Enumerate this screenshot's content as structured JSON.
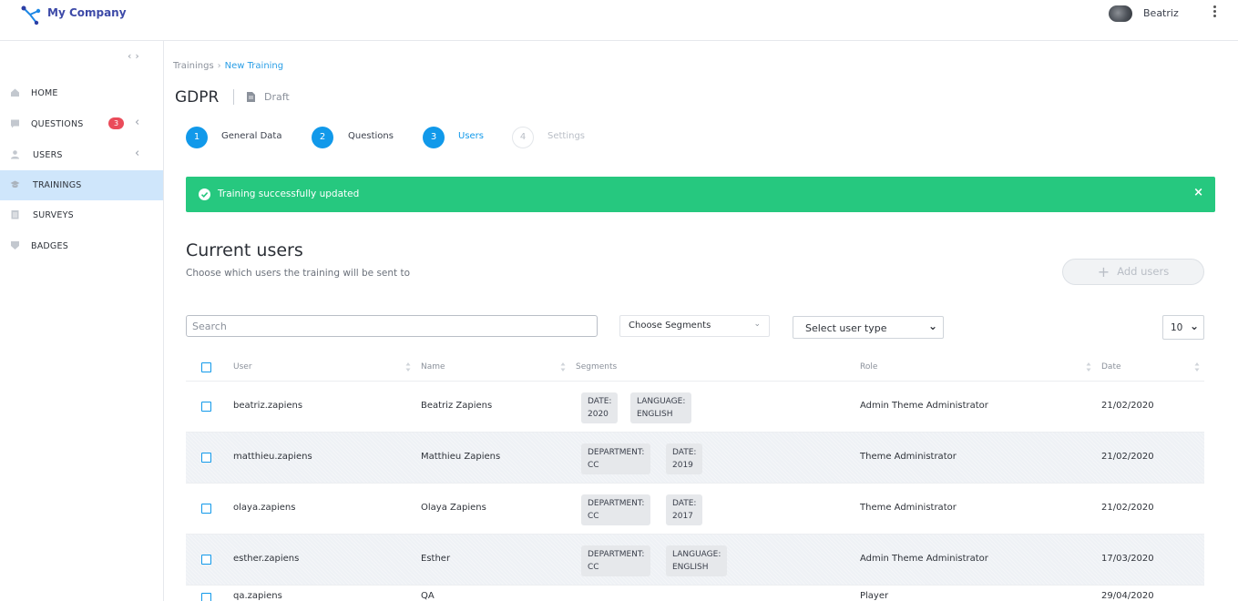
{
  "app": {
    "company_name": "My Company"
  },
  "user": {
    "name": "Beatriz"
  },
  "sidebar": {
    "items": [
      {
        "label": "HOME",
        "icon": "home-icon"
      },
      {
        "label": "QUESTIONS",
        "icon": "questions-icon",
        "badge": "3"
      },
      {
        "label": "USERS",
        "icon": "user-icon"
      },
      {
        "label": "TRAININGS",
        "icon": "trainings-icon",
        "active": true
      },
      {
        "label": "SURVEYS",
        "icon": "surveys-icon"
      },
      {
        "label": "BADGES",
        "icon": "badge-icon"
      }
    ]
  },
  "breadcrumb": {
    "parent": "Trainings",
    "current": "New Training"
  },
  "page": {
    "title": "GDPR",
    "status": "Draft"
  },
  "steps": [
    {
      "number": "1",
      "label": "General Data",
      "state": "done"
    },
    {
      "number": "2",
      "label": "Questions",
      "state": "done"
    },
    {
      "number": "3",
      "label": "Users",
      "state": "active"
    },
    {
      "number": "4",
      "label": "Settings",
      "state": "inactive"
    }
  ],
  "alert": {
    "message": "Training successfully updated",
    "close": "×",
    "color": "#26c87f"
  },
  "section": {
    "title": "Current users",
    "subtitle": "Choose which users the training will be sent to",
    "add_users_label": "Add users"
  },
  "filters": {
    "search_placeholder": "Search",
    "segments_label": "Choose Segments",
    "user_type_label": "Select user type",
    "page_size": "10"
  },
  "table": {
    "columns": [
      "User",
      "Name",
      "Segments",
      "Role",
      "Date"
    ],
    "rows": [
      {
        "user": "beatriz.zapiens",
        "name": "Beatriz Zapiens",
        "segments": [
          [
            "DATE:",
            "2020"
          ],
          [
            "LANGUAGE:",
            "ENGLISH"
          ]
        ],
        "role": "Admin Theme Administrator",
        "date": "21/02/2020"
      },
      {
        "user": "matthieu.zapiens",
        "name": "Matthieu Zapiens",
        "segments": [
          [
            "DEPARTMENT:",
            "CC"
          ],
          [
            "DATE:",
            "2019"
          ]
        ],
        "role": "Theme Administrator",
        "date": "21/02/2020"
      },
      {
        "user": "olaya.zapiens",
        "name": "Olaya Zapiens",
        "segments": [
          [
            "DEPARTMENT:",
            "CC"
          ],
          [
            "DATE:",
            "2017"
          ]
        ],
        "role": "Theme Administrator",
        "date": "21/02/2020"
      },
      {
        "user": "esther.zapiens",
        "name": "Esther",
        "segments": [
          [
            "DEPARTMENT:",
            "CC"
          ],
          [
            "LANGUAGE:",
            "ENGLISH"
          ]
        ],
        "role": "Admin Theme Administrator",
        "date": "17/03/2020"
      },
      {
        "user": "qa.zapiens",
        "name": "QA",
        "segments": [],
        "role": "Player",
        "date": "29/04/2020"
      }
    ]
  },
  "colors": {
    "accent": "#1199ea",
    "brand": "#3d4aa8",
    "badge": "#ea4b5a",
    "active_nav": "#cfe6fb"
  }
}
